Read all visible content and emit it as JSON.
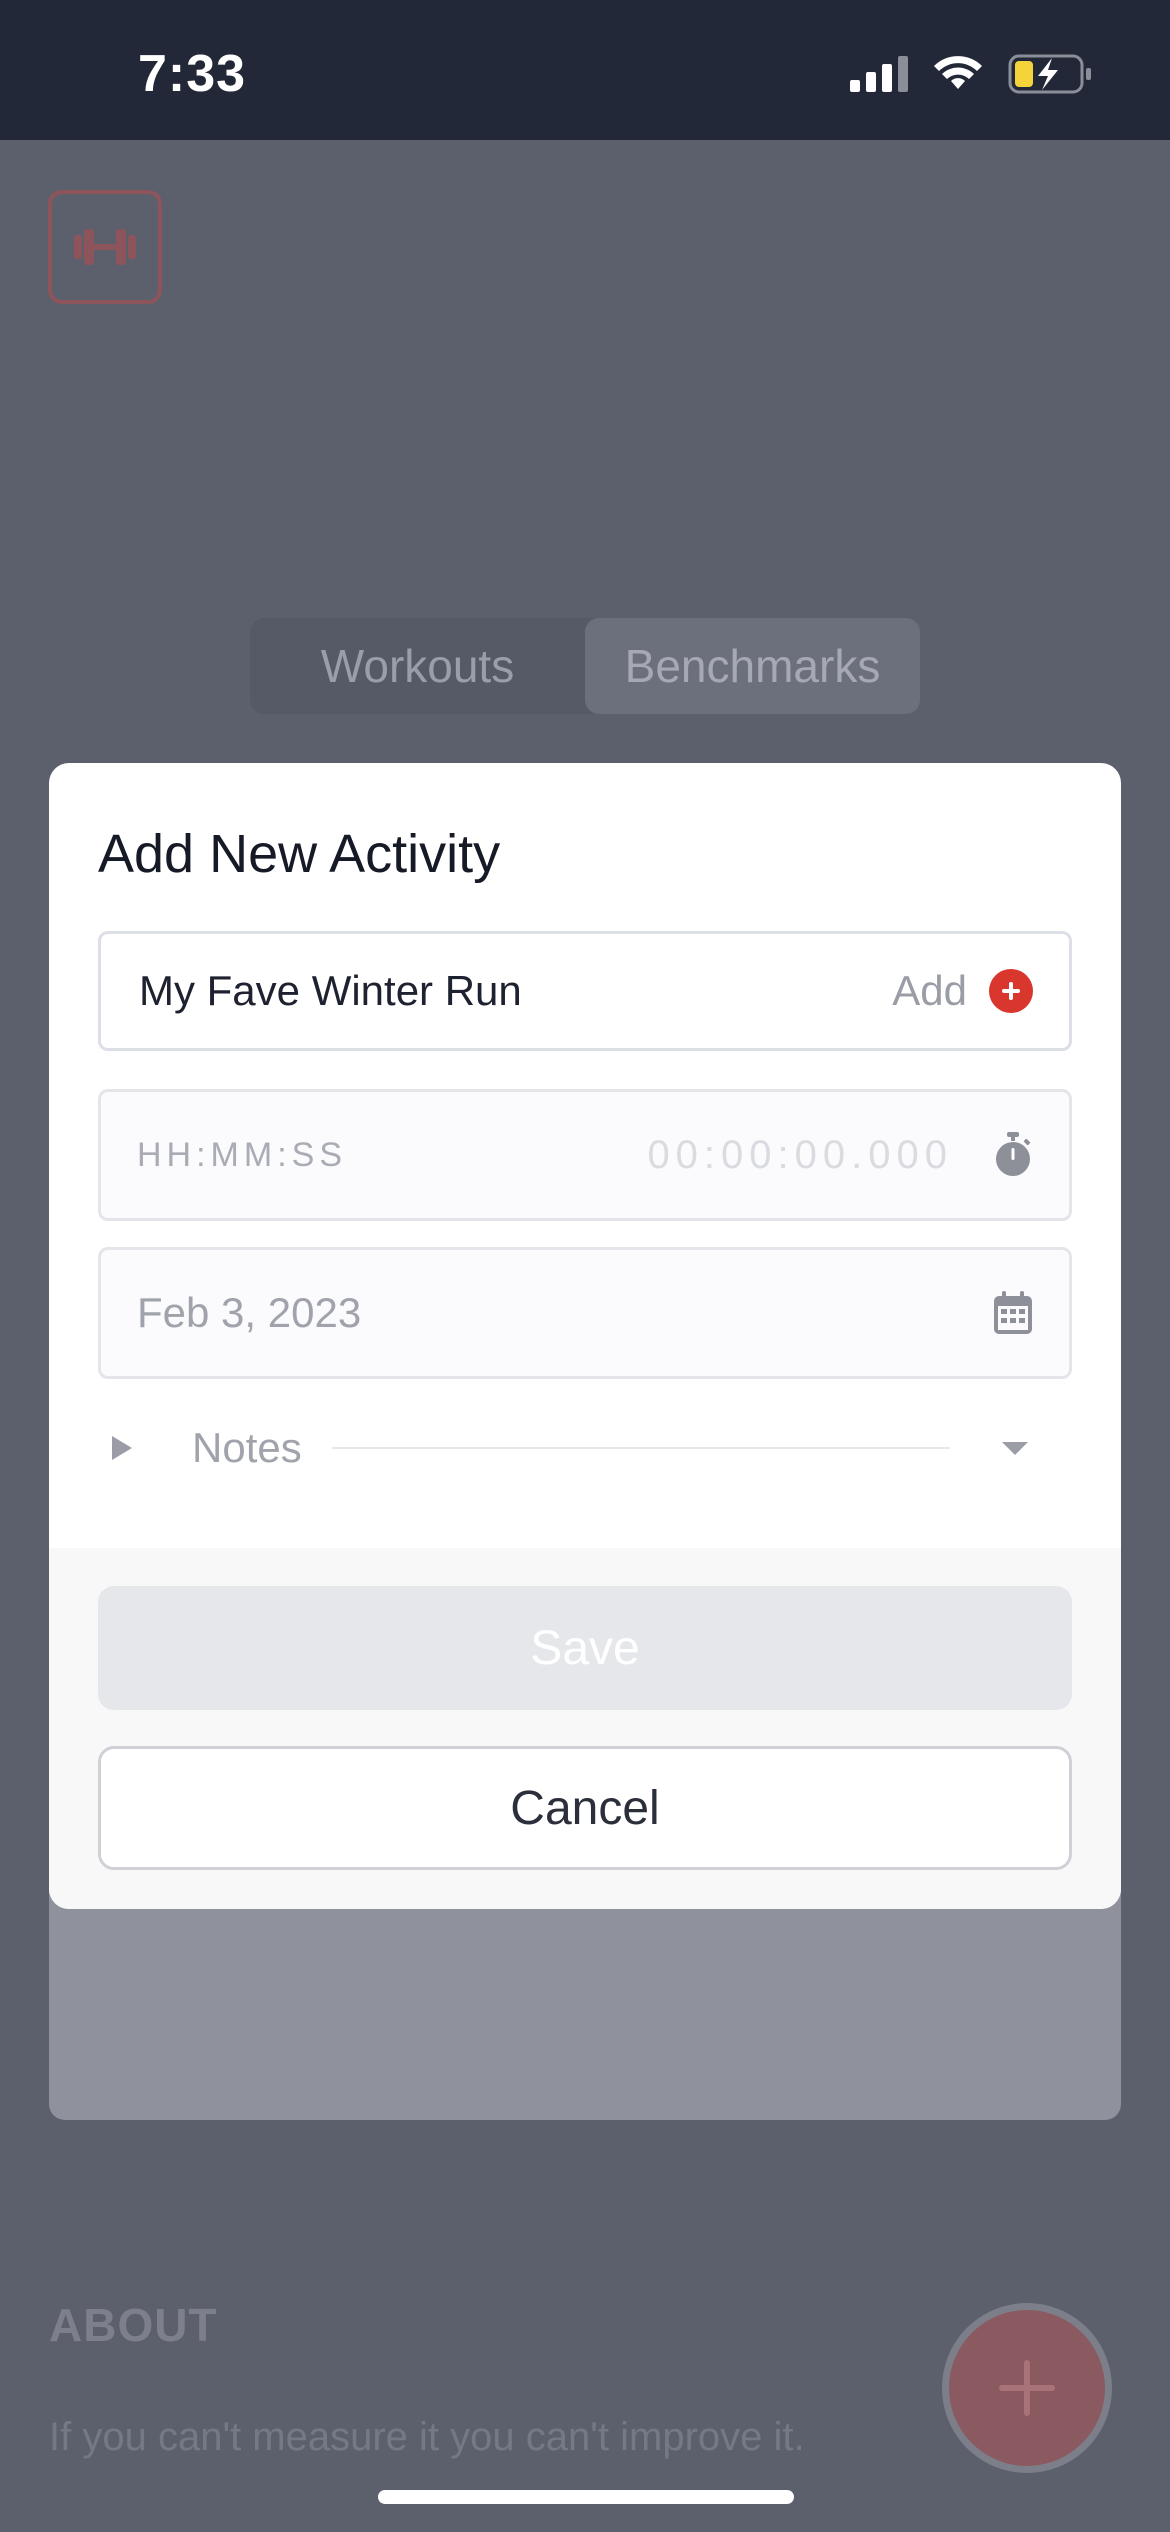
{
  "status_bar": {
    "time": "7:33"
  },
  "background": {
    "tabs": [
      {
        "label": "Workouts",
        "active": false
      },
      {
        "label": "Benchmarks",
        "active": true
      }
    ],
    "about": {
      "heading": "ABOUT",
      "text": "If you can't measure it you can't improve it."
    }
  },
  "modal": {
    "title": "Add New Activity",
    "activity_input": {
      "value": "My Fave Winter Run",
      "add_label": "Add"
    },
    "time_field": {
      "placeholder": "HH:MM:SS",
      "value": "00:00:00.000"
    },
    "date_field": {
      "value": "Feb 3, 2023"
    },
    "notes_label": "Notes",
    "save_label": "Save",
    "cancel_label": "Cancel"
  },
  "colors": {
    "accent_red": "#d9362e",
    "status_bar_bg": "#232838",
    "overlay_bg": "#5c606d"
  },
  "icons": [
    "dumbbell-icon",
    "stopwatch-icon",
    "calendar-icon",
    "plus-circle-icon",
    "caret-right-icon",
    "caret-down-icon",
    "plus-icon"
  ]
}
